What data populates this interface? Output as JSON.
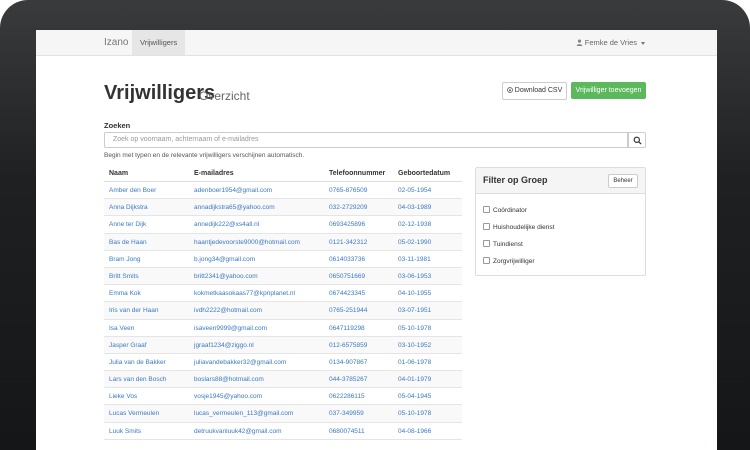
{
  "navbar": {
    "brand": "Izano",
    "active_tab": "Vrijwilligers",
    "user": "Femke de Vries"
  },
  "page": {
    "title": "Vrijwilligers",
    "subtitle": "Overzicht"
  },
  "actions": {
    "download_csv": "Download CSV",
    "add_volunteer": "Vrijwilliger toevoegen"
  },
  "search": {
    "label": "Zoeken",
    "placeholder": "Zoek op voornaam, achternaam of e-mailadres",
    "hint": "Begin met typen en de relevante vrijwilligers verschijnen automatisch."
  },
  "table": {
    "headers": [
      "Naam",
      "E-mailadres",
      "Telefoonnummer",
      "Geboortedatum"
    ],
    "rows": [
      [
        "Amber den Boer",
        "adenboer1954@gmail.com",
        "0765-876509",
        "02-05-1954"
      ],
      [
        "Anna Dijkstra",
        "annadijkstra65@yahoo.com",
        "032-2729209",
        "04-03-1989"
      ],
      [
        "Anne ter Dijk",
        "annedijk222@xs4all.nl",
        "0693425896",
        "02-12-1938"
      ],
      [
        "Bas de Haan",
        "haantjedevoorste9000@hotmail.com",
        "0121-342312",
        "05-02-1990"
      ],
      [
        "Bram Jong",
        "b.jong34@gmail.com",
        "0614033736",
        "03-11-1981"
      ],
      [
        "Britt Smits",
        "britt2341@yahoo.com",
        "0650751669",
        "03-06-1953"
      ],
      [
        "Emma Kok",
        "kokmetkaasokaas77@kpnplanet.nl",
        "0674423345",
        "04-10-1955"
      ],
      [
        "Iris van der Haan",
        "ivdh2222@hotmail.com",
        "0765-251944",
        "03-07-1951"
      ],
      [
        "Isa Veen",
        "isaveen9999@gmail.com",
        "0647119298",
        "05-10-1978"
      ],
      [
        "Jasper Graaf",
        "jgraaf1234@ziggo.nl",
        "012-6575859",
        "03-10-1952"
      ],
      [
        "Julia van de Bakker",
        "juliavandebakker32@gmail.com",
        "0134-907867",
        "01-06-1978"
      ],
      [
        "Lars van den Bosch",
        "boslars88@hotmail.com",
        "044-3785267",
        "04-01-1979"
      ],
      [
        "Lieke Vos",
        "vosje1945@yahoo.com",
        "0622286115",
        "05-04-1945"
      ],
      [
        "Lucas Vermeulen",
        "lucas_vermeulen_113@gmail.com",
        "037-349959",
        "05-10-1978"
      ],
      [
        "Luuk Smits",
        "detruukvanluuk42@gmail.com",
        "0680074511",
        "04-08-1966"
      ]
    ]
  },
  "filter": {
    "title": "Filter op Groep",
    "manage": "Beheer",
    "groups": [
      "Coördinator",
      "Huishoudelijke dienst",
      "Tuindienst",
      "Zorgvrijwilliger"
    ]
  }
}
